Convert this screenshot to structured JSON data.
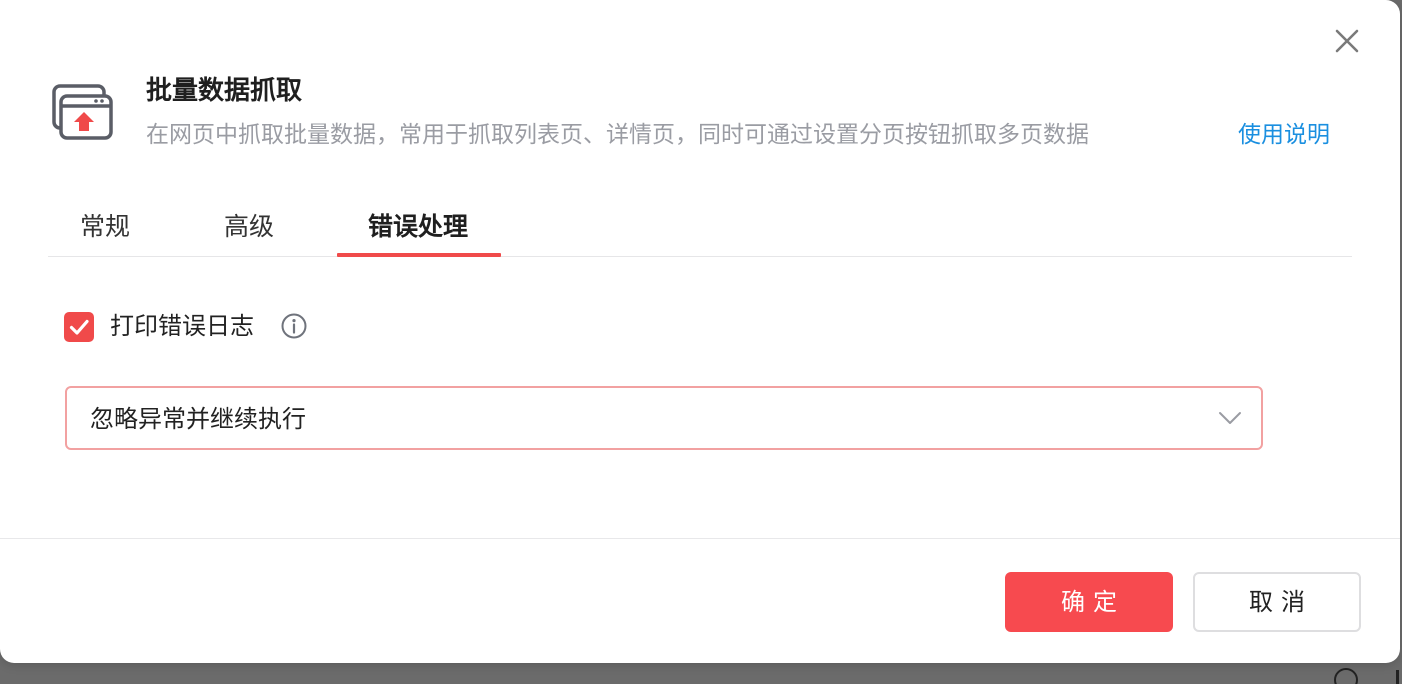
{
  "dialog": {
    "title": "批量数据抓取",
    "subtitle": "在网页中抓取批量数据，常用于抓取列表页、详情页，同时可通过设置分页按钮抓取多页数据",
    "help_link": "使用说明",
    "icon": "web-page-upload-icon",
    "close_icon": "close-icon"
  },
  "tabs": [
    {
      "label": "常规",
      "active": false
    },
    {
      "label": "高级",
      "active": false
    },
    {
      "label": "错误处理",
      "active": true
    }
  ],
  "error_handling": {
    "print_log": {
      "label": "打印错误日志",
      "checked": true,
      "info_icon": "info-icon"
    },
    "strategy_select": {
      "value": "忽略异常并继续执行",
      "icon": "chevron-down-icon"
    }
  },
  "footer": {
    "confirm_label": "确定",
    "cancel_label": "取消"
  },
  "colors": {
    "accent": "#f04a4a",
    "confirm_bg": "#f74a4f",
    "link": "#1a8fe0",
    "subtitle": "#9a9ca3",
    "select_border": "#f2a1a1"
  }
}
